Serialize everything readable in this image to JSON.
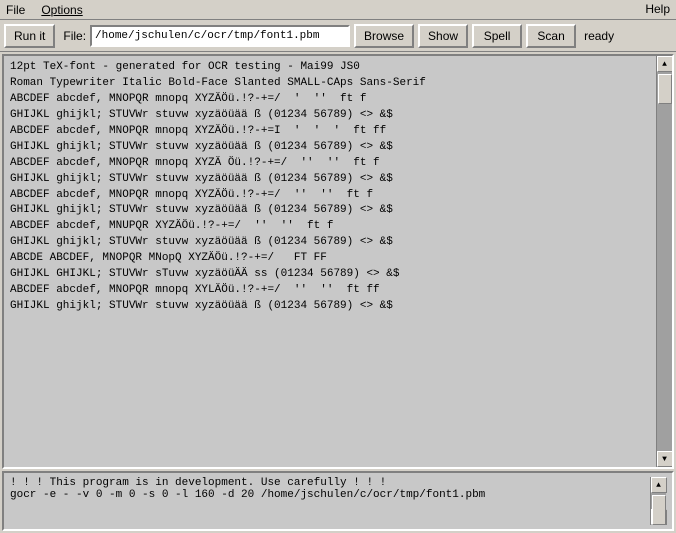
{
  "menubar": {
    "file_label": "File",
    "options_label": "Options",
    "help_label": "Help"
  },
  "toolbar": {
    "run_label": "Run it",
    "file_label": "File:",
    "file_path": "/home/jschulen/c/ocr/tmp/font1.pbm",
    "browse_label": "Browse",
    "show_label": "Show",
    "spell_label": "Spell",
    "scan_label": "Scan",
    "status_label": "ready"
  },
  "main_text": {
    "lines": [
      "12pt TeX-font - generated for OCR testing - Mai99 JS0",
      "Roman Typewriter Italic Bold-Face Slanted SMALL-CAps Sans-Serif",
      "ABCDEF abcdef, MNOPQR mnopq XYZÄÖü.!?-+=/  '  ''  ft f",
      "GHIJKL ghijkl; STUVWr stuvw xyzäöüää ß (01234 56789) <> &$",
      "ABCDEF abcdef, MNOPQR mnopq XYZÄÖü.!?-+=I  '  '  '  ft ff",
      "GHIJKL ghijkl; STUVWr stuvw xyzäöüää ß (01234 56789) <> &$",
      "ABCDEF abcdef, MNOPQR mnopq XYZÄ Öü.!?-+=/  ''  ''  ft f",
      "GHIJKL ghijkl; STUVWr stuvw xyzäöüää ß (01234 56789) <> &$",
      "ABCDEF abcdef, MNOPQR mnopq XYZÄÖü.!?-+=/  ''  ''  ft f",
      "GHIJKL ghijkl; STUVWr stuvw xyzäöüää ß (01234 56789) <> &$",
      "ABCDEF abcdef, MNUPQR XYZÄÖü.!?-+=/  ''  ''  ft f",
      "GHIJKL ghijkl; STUVWr stuvw xyzäöüää ß (01234 56789) <> &$",
      "ABCDE ABCDEF, MNOPQR MNopQ XYZÄÖü.!?-+=/   FT FF",
      "GHIJKL GHIJKL; STUVWr sTuvw xyzäöüÄÄ ss (01234 56789) <> &$",
      "ABCDEF abcdef, MNOPQR mnopq XYLÄÖü.!?-+=/  ''  ''  ft ff",
      "GHIJKL ghijkl; STUVWr stuvw xyzäöüää ß (01234 56789) <> &$"
    ]
  },
  "status_bar": {
    "line1": "! ! !  This program is in development.  Use carefully ! ! !",
    "line2": "gocr -e - -v 0 -m 0 -s 0 -l 160 -d 20 /home/jschulen/c/ocr/tmp/font1.pbm"
  },
  "icons": {
    "arrow_up": "▲",
    "arrow_down": "▼"
  }
}
